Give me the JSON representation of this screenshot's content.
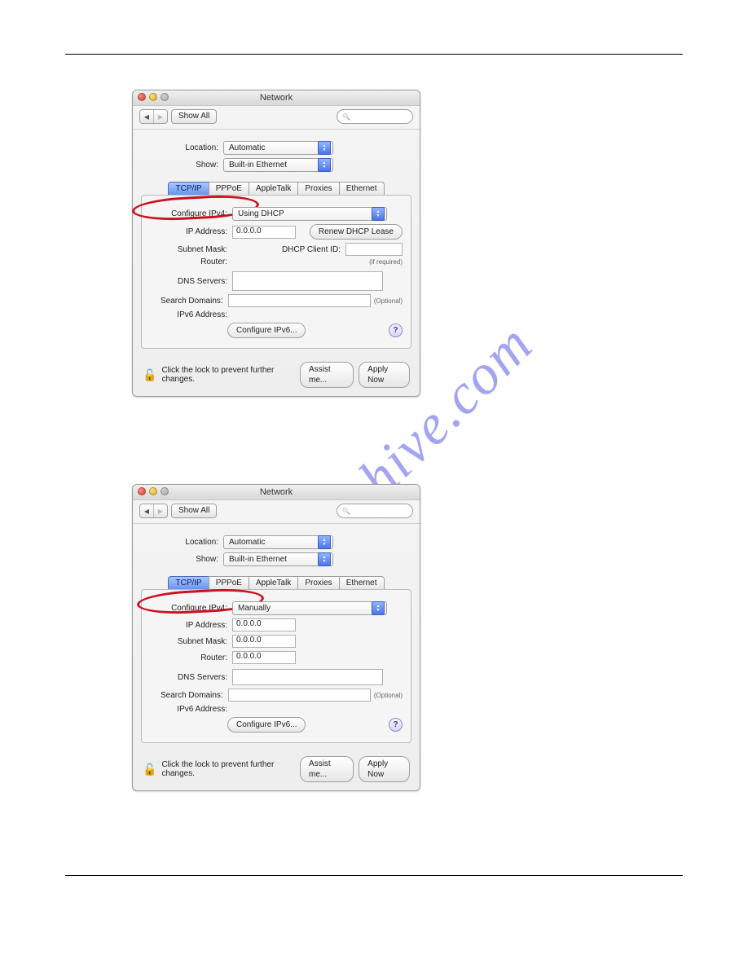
{
  "watermark": "manualshive.com",
  "window1": {
    "title": "Network",
    "nav": {
      "show_all": "Show All"
    },
    "search_placeholder": "",
    "location_label": "Location:",
    "show_label": "Show:",
    "location_value": "Automatic",
    "show_value": "Built-in Ethernet",
    "tabs": [
      "TCP/IP",
      "PPPoE",
      "AppleTalk",
      "Proxies",
      "Ethernet"
    ],
    "active_tab": 0,
    "fields": {
      "configure_ipv4_label": "Configure IPv4:",
      "configure_ipv4_value": "Using DHCP",
      "ip_address_label": "IP Address:",
      "ip_address_value": "0.0.0.0",
      "renew_dhcp_label": "Renew DHCP Lease",
      "subnet_mask_label": "Subnet Mask:",
      "dhcp_client_id_label": "DHCP Client ID:",
      "dhcp_client_id_hint": "(if required)",
      "router_label": "Router:",
      "dns_servers_label": "DNS Servers:",
      "search_domains_label": "Search Domains:",
      "search_domains_hint": "(Optional)",
      "ipv6_address_label": "IPv6 Address:",
      "configure_ipv6_btn": "Configure IPv6..."
    },
    "footer": {
      "lock_text": "Click the lock to prevent further changes.",
      "assist_me": "Assist me...",
      "apply_now": "Apply Now"
    }
  },
  "window2": {
    "title": "Network",
    "nav": {
      "show_all": "Show All"
    },
    "search_placeholder": "",
    "location_label": "Location:",
    "show_label": "Show:",
    "location_value": "Automatic",
    "show_value": "Built-in Ethernet",
    "tabs": [
      "TCP/IP",
      "PPPoE",
      "AppleTalk",
      "Proxies",
      "Ethernet"
    ],
    "active_tab": 0,
    "fields": {
      "configure_ipv4_label": "Configure IPv4:",
      "configure_ipv4_value": "Manually",
      "ip_address_label": "IP Address:",
      "ip_address_value": "0.0.0.0",
      "subnet_mask_label": "Subnet Mask:",
      "subnet_mask_value": "0.0.0.0",
      "router_label": "Router:",
      "router_value": "0.0.0.0",
      "dns_servers_label": "DNS Servers:",
      "search_domains_label": "Search Domains:",
      "search_domains_hint": "(Optional)",
      "ipv6_address_label": "IPv6 Address:",
      "configure_ipv6_btn": "Configure IPv6..."
    },
    "footer": {
      "lock_text": "Click the lock to prevent further changes.",
      "assist_me": "Assist me...",
      "apply_now": "Apply Now"
    }
  }
}
